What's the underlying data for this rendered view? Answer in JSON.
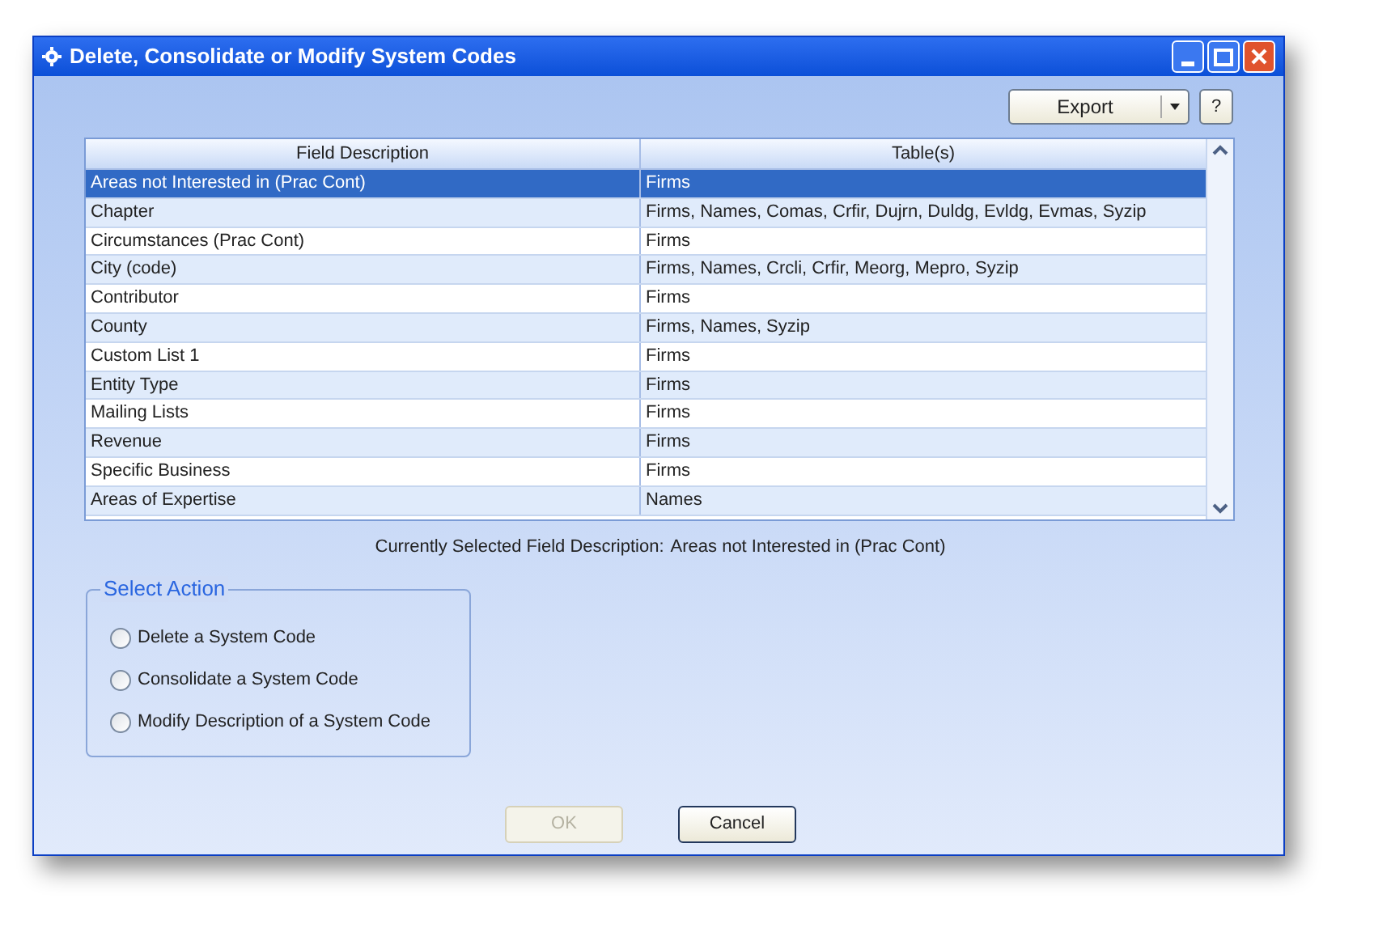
{
  "window": {
    "title": "Delete, Consolidate or Modify System Codes"
  },
  "toolbar": {
    "export_button": "Export",
    "help_button": "?"
  },
  "table": {
    "columns": [
      "Field Description",
      "Table(s)"
    ],
    "rows": [
      {
        "cells": [
          "Areas not Interested in (Prac Cont)",
          "Firms"
        ],
        "selected": true
      },
      {
        "cells": [
          "Chapter",
          "Firms, Names, Comas, Crfir, Dujrn, Duldg, Evldg, Evmas, Syzip"
        ],
        "selected": false
      },
      {
        "cells": [
          "Circumstances (Prac Cont)",
          "Firms"
        ],
        "selected": false
      },
      {
        "cells": [
          "City (code)",
          "Firms, Names, Crcli, Crfir, Meorg, Mepro, Syzip"
        ],
        "selected": false
      },
      {
        "cells": [
          "Contributor",
          "Firms"
        ],
        "selected": false
      },
      {
        "cells": [
          "County",
          "Firms, Names, Syzip"
        ],
        "selected": false
      },
      {
        "cells": [
          "Custom List 1",
          "Firms"
        ],
        "selected": false
      },
      {
        "cells": [
          "Entity Type",
          "Firms"
        ],
        "selected": false
      },
      {
        "cells": [
          "Mailing Lists",
          "Firms"
        ],
        "selected": false
      },
      {
        "cells": [
          "Revenue",
          "Firms"
        ],
        "selected": false
      },
      {
        "cells": [
          "Specific Business",
          "Firms"
        ],
        "selected": false
      },
      {
        "cells": [
          "Areas of Expertise",
          "Names"
        ],
        "selected": false
      }
    ]
  },
  "current_selection": {
    "label": "Currently Selected Field Description:",
    "value": "Areas not Interested in (Prac Cont)"
  },
  "select_action": {
    "title": "Select Action",
    "options": [
      {
        "label": "Delete a System Code",
        "selected": false
      },
      {
        "label": "Consolidate a System Code",
        "selected": false
      },
      {
        "label": "Modify Description of a System Code",
        "selected": false
      }
    ]
  },
  "buttons": [
    {
      "label": "OK",
      "disabled": true
    },
    {
      "label": "Cancel",
      "disabled": false
    }
  ]
}
